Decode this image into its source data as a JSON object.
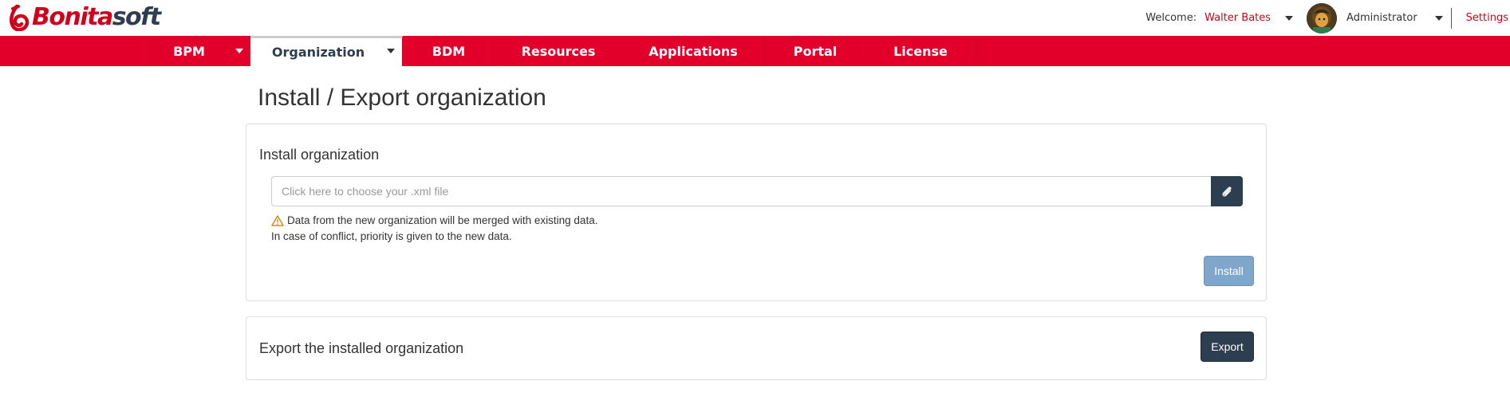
{
  "brand": {
    "logo_text_1": "Bonita",
    "logo_text_2": "soft"
  },
  "header": {
    "welcome_label": "Welcome:",
    "user_name": "Walter Bates",
    "profile_name": "Administrator",
    "settings_label": "Settings"
  },
  "nav": {
    "items": [
      {
        "label": "BPM",
        "has_caret": true,
        "active": false
      },
      {
        "label": "Organization",
        "has_caret": true,
        "active": true
      },
      {
        "label": "BDM",
        "has_caret": false,
        "active": false
      },
      {
        "label": "Resources",
        "has_caret": false,
        "active": false
      },
      {
        "label": "Applications",
        "has_caret": false,
        "active": false
      },
      {
        "label": "Portal",
        "has_caret": false,
        "active": false
      },
      {
        "label": "License",
        "has_caret": false,
        "active": false
      }
    ]
  },
  "page": {
    "title": "Install / Export organization"
  },
  "install": {
    "heading": "Install organization",
    "file_placeholder": "Click here to choose your .xml file",
    "attach_icon": "paperclip-icon",
    "notice_line1": "Data from the new organization will be merged with existing data.",
    "notice_line2": "In case of conflict, priority is given to the new data.",
    "warning_icon": "warning-icon",
    "button_label": "Install"
  },
  "export": {
    "heading": "Export the installed organization",
    "button_label": "Export"
  },
  "colors": {
    "brand_red": "#e2002a",
    "dark_navy": "#2c3e50",
    "disabled_blue": "#7fa7cc",
    "warning_orange": "#d38b1a"
  }
}
